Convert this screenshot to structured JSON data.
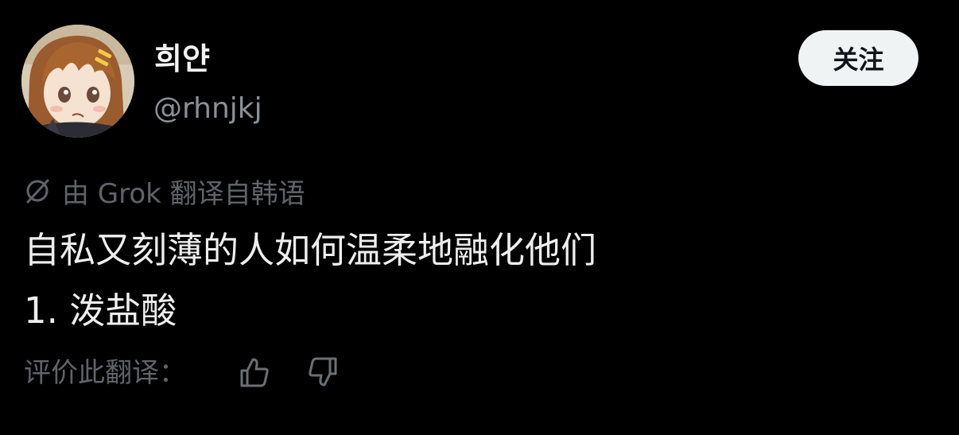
{
  "user": {
    "display_name": "희얀",
    "handle": "@rhnjkj"
  },
  "follow_label": "关注",
  "translation": {
    "note": "由 Grok 翻译自韩语"
  },
  "tweet": {
    "line1": "自私又刻薄的人如何温柔地融化他们",
    "line2": "1. 泼盐酸"
  },
  "rating": {
    "label": "评价此翻译："
  },
  "colors": {
    "background": "#000000",
    "follow_button_bg": "#eff3f4",
    "muted_text": "#5f6469",
    "handle_text": "#8b9096"
  },
  "icons": {
    "grok": "grok-icon",
    "thumb_up": "thumb-up-icon",
    "thumb_down": "thumb-down-icon"
  }
}
